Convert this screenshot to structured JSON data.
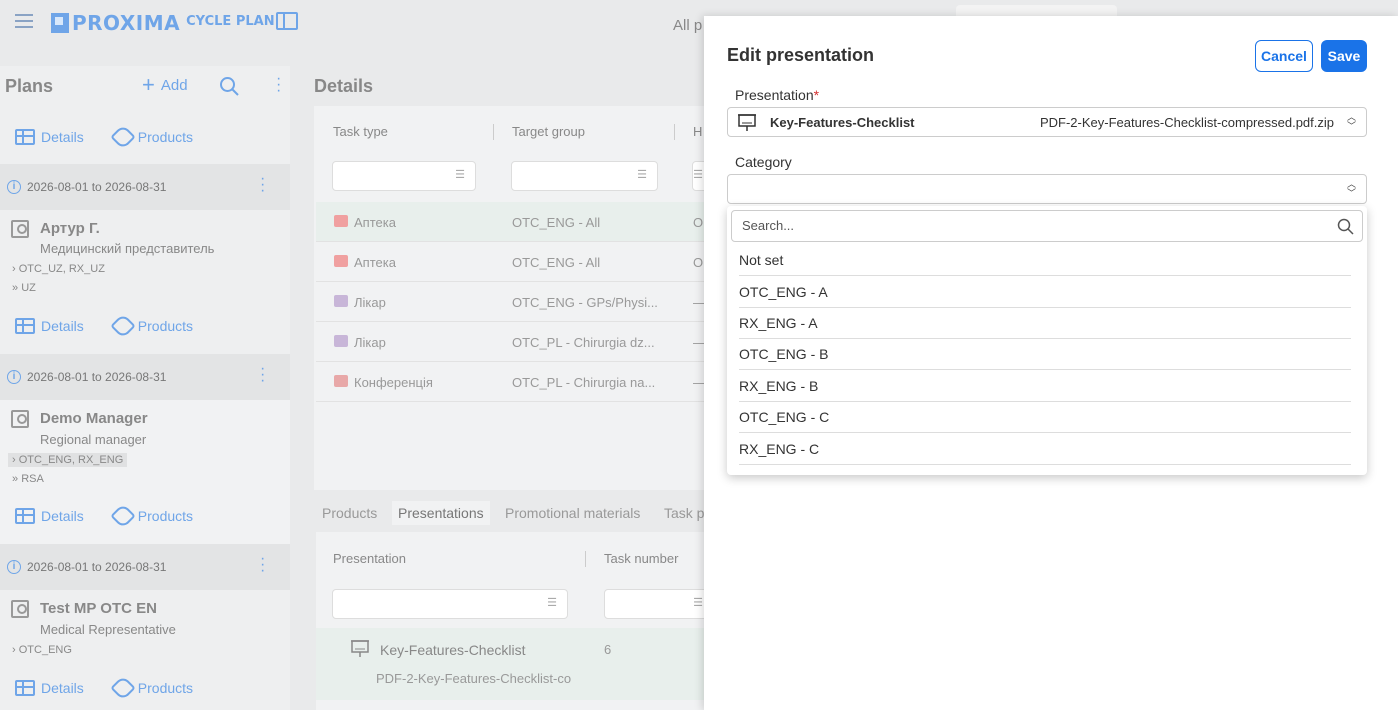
{
  "app": {
    "logo_text": "PROXIMA",
    "logo_sub": "CYCLE PLAN",
    "top_label": "All p"
  },
  "sidebar": {
    "title": "Plans",
    "add_label": "Add",
    "links": {
      "details": "Details",
      "products": "Products"
    },
    "plans": [
      {
        "date": "2026-08-01 to 2026-08-31",
        "name": "Артур Г.",
        "role": "Медицинский представитель",
        "chip1": "OTC_UZ, RX_UZ",
        "chip2": "UZ"
      },
      {
        "date": "2026-08-01 to 2026-08-31",
        "name": "Demo Manager",
        "role": "Regional manager",
        "chip1": "OTC_ENG, RX_ENG",
        "chip2": "RSA"
      },
      {
        "date": "2026-08-01 to 2026-08-31",
        "name": "Test MP OTC EN",
        "role": "Medical Representative",
        "chip1": "OTC_ENG",
        "chip2": ""
      }
    ]
  },
  "main": {
    "title": "Details",
    "columns": [
      "Task type",
      "Target group",
      "H"
    ],
    "rows": [
      {
        "type": "Аптека",
        "group": "OTC_ENG - All",
        "h": "O"
      },
      {
        "type": "Аптека",
        "group": "OTC_ENG - All",
        "h": "O"
      },
      {
        "type": "Лікар",
        "group": "OTC_ENG - GPs/Physi...",
        "h": "—"
      },
      {
        "type": "Лікар",
        "group": "OTC_PL - Chirurgia dz...",
        "h": "—"
      },
      {
        "type": "Конференція",
        "group": "OTC_PL - Chirurgia na...",
        "h": "—"
      }
    ],
    "tabs": [
      "Products",
      "Presentations",
      "Promotional materials",
      "Task p"
    ],
    "lower_columns": [
      "Presentation",
      "Task number"
    ],
    "lower_row": {
      "name": "Key-Features-Checklist",
      "file": "PDF-2-Key-Features-Checklist-co",
      "task_number": "6"
    }
  },
  "dialog": {
    "title": "Edit presentation",
    "cancel": "Cancel",
    "save": "Save",
    "presentation_label": "Presentation",
    "required_mark": "*",
    "presentation_name": "Key-Features-Checklist",
    "presentation_file": "PDF-2-Key-Features-Checklist-compressed.pdf.zip",
    "category_label": "Category",
    "search_placeholder": "Search...",
    "options": [
      "Not set",
      "OTC_ENG - A",
      "RX_ENG - A",
      "OTC_ENG - B",
      "RX_ENG - B",
      "OTC_ENG - C",
      "RX_ENG - C"
    ]
  },
  "colors": {
    "accent": "#1a73e8",
    "link": "#6fa5e8",
    "required": "#d32f2f"
  }
}
